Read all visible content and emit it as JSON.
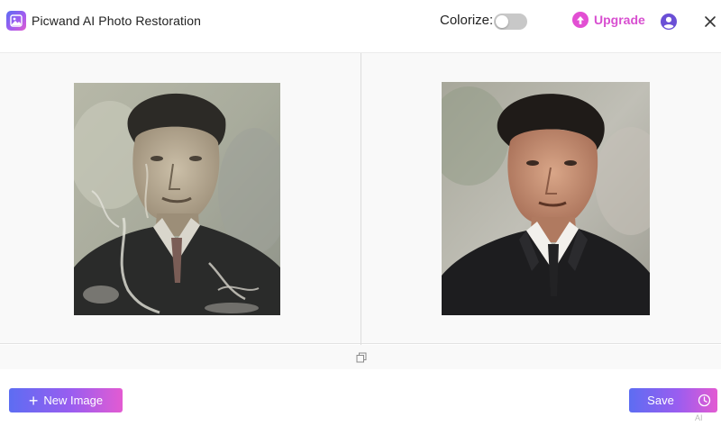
{
  "header": {
    "app_title": "Picwand AI Photo Restoration",
    "logo_icon": "image-logo-icon",
    "colorize": {
      "label": "Colorize:",
      "enabled": false
    },
    "upgrade_label": "Upgrade",
    "account_icon": "account-circle-icon",
    "close_icon": "close-icon"
  },
  "compare": {
    "original_image": {
      "kind": "damaged-vintage-portrait"
    },
    "restored_image": {
      "kind": "restored-colorized-portrait"
    },
    "toggle_icon": "compare-toggle-icon"
  },
  "footer": {
    "new_image_label": "New Image",
    "new_image_icon": "plus-icon",
    "save_label": "Save",
    "history_icon": "history-clock-icon",
    "corner_mark": "AI"
  },
  "colors": {
    "accent_gradient_start": "#5d6df2",
    "accent_gradient_mid": "#9a5df0",
    "accent_gradient_end": "#e35bd2",
    "upgrade": "#d84fd0",
    "toggle_off": "#c8c8c8",
    "panel_bg": "#f9f9f9"
  }
}
